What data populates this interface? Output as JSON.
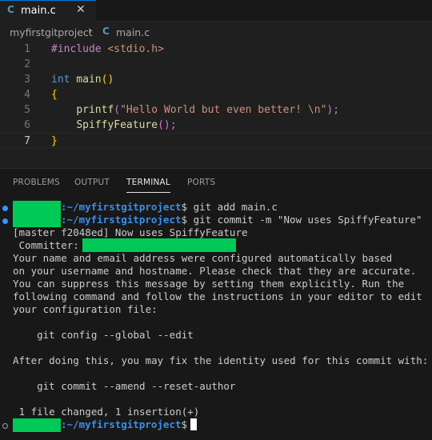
{
  "tab": {
    "icon": "C",
    "label": "main.c",
    "close": "✕"
  },
  "breadcrumb": {
    "folder": "myfirstgitproject",
    "separator": "›",
    "icon": "C",
    "file": "main.c"
  },
  "editor": {
    "line_numbers": [
      "1",
      "2",
      "3",
      "4",
      "5",
      "6",
      "7"
    ],
    "current_line": "7",
    "code": {
      "l1_directive": "#include",
      "l1_header": " <stdio.h>",
      "l3_type": "int",
      "l3_name": " main",
      "l3_parens": "()",
      "l4_brace": "{",
      "l5_fn": "printf",
      "l5_open": "(",
      "l5_string": "\"Hello World but even better! \\n\"",
      "l5_close": ");",
      "l6_fn": "SpiffyFeature",
      "l6_call": "();",
      "l7_brace": "}"
    }
  },
  "panel": {
    "tabs": [
      "PROBLEMS",
      "OUTPUT",
      "TERMINAL",
      "PORTS"
    ],
    "active_tab": "TERMINAL"
  },
  "terminal": {
    "prompt_path": ":~/myfirstgitproject",
    "prompt_symbol": "$",
    "cmd1": " git add main.c",
    "cmd2": " git commit -m \"Now uses SpiffyFeature\"",
    "out1": "[master f2048ed] Now uses SpiffyFeature",
    "out2": " Committer: ",
    "out3": "Your name and email address were configured automatically based",
    "out4": "on your username and hostname. Please check that they are accurate.",
    "out5": "You can suppress this message by setting them explicitly. Run the",
    "out6": "following command and follow the instructions in your editor to edit",
    "out7": "your configuration file:",
    "out8": "    git config --global --edit",
    "out9": "After doing this, you may fix the identity used for this commit with:",
    "out10": "    git commit --amend --reset-author",
    "out11": " 1 file changed, 1 insertion(+)"
  },
  "colors": {
    "accent": "#0078d4",
    "redaction": "#00c957",
    "prompt_path": "#3b8eea",
    "decoration_dot": "#3794ff"
  }
}
